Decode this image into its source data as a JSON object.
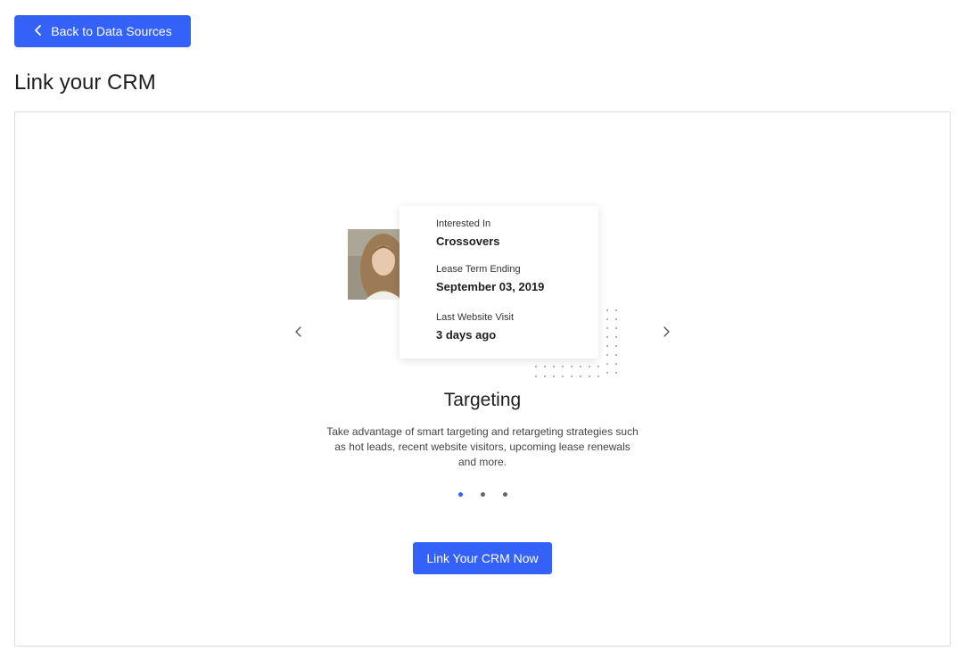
{
  "header": {
    "back_button_label": "Back to Data Sources",
    "page_title": "Link your CRM"
  },
  "slide": {
    "card": {
      "items": [
        {
          "label": "Interested In",
          "value": "Crossovers"
        },
        {
          "label": "Lease Term Ending",
          "value": "September 03, 2019"
        },
        {
          "label": "Last Website Visit",
          "value": "3 days ago"
        }
      ]
    },
    "title": "Targeting",
    "description": "Take advantage of smart targeting and retargeting strategies such as hot leads, recent website visitors, upcoming lease renewals and more.",
    "pager": {
      "count": 3,
      "active_index": 0
    }
  },
  "cta": {
    "label": "Link Your CRM Now"
  },
  "colors": {
    "accent": "#3461f7",
    "pager_inactive": "#666666",
    "border": "#dcdcdc"
  },
  "icons": {
    "back": "chevron-left-icon",
    "prev": "chevron-left-icon",
    "next": "chevron-right-icon"
  }
}
